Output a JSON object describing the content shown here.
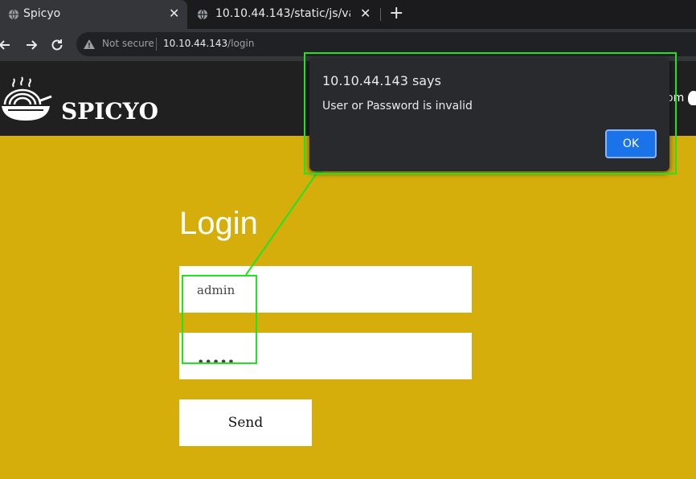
{
  "browser": {
    "tabs": [
      {
        "title": "Spicyo",
        "active": true
      },
      {
        "title": "10.10.44.143/static/js/valid",
        "active": false
      }
    ],
    "new_tab_label": "+",
    "close_glyph": "✕",
    "security_label": "Not secure",
    "url_host": "10.10.44.143",
    "url_path": "/login"
  },
  "site": {
    "brand": "SPICYO",
    "nav_partial": "om"
  },
  "login": {
    "title": "Login",
    "username_value": "admin",
    "password_value": "•••••",
    "send_label": "Send"
  },
  "dialog": {
    "title": "10.10.44.143 says",
    "message": "User or Password is invalid",
    "ok_label": "OK"
  },
  "colors": {
    "page_bg": "#d6ae0c",
    "header_bg": "#202020",
    "annotation": "#22e222",
    "ok_button": "#1a73e8"
  },
  "icons": [
    "globe-icon",
    "back-arrow-icon",
    "forward-arrow-icon",
    "reload-icon",
    "warning-icon",
    "noodle-bowl-logo-icon"
  ]
}
